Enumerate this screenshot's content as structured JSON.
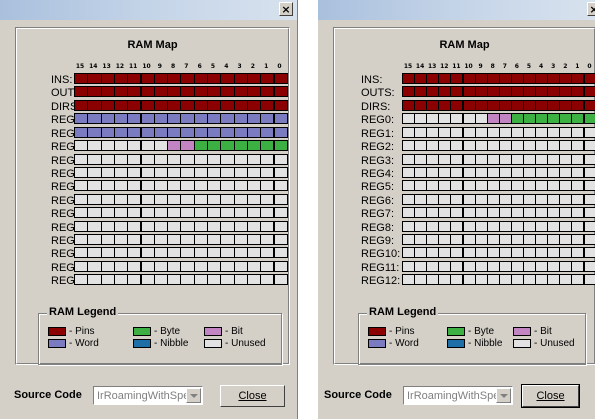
{
  "window_close_glyph": "×",
  "ram_map_title": "RAM Map",
  "bit_numbers": [
    "15",
    "14",
    "13",
    "12",
    "11",
    "10",
    "9",
    "8",
    "7",
    "6",
    "5",
    "4",
    "3",
    "2",
    "1",
    "0"
  ],
  "colors": {
    "pins": "#8b0000",
    "word": "#7b7bc1",
    "byte": "#3cb043",
    "nibble": "#1e6fa8",
    "bit": "#c384c3",
    "unused": "#e2e2e2"
  },
  "register_labels": [
    "INS:",
    "OUTS:",
    "DIRS:",
    "REG0:",
    "REG1:",
    "REG2:",
    "REG3:",
    "REG4:",
    "REG5:",
    "REG6:",
    "REG7:",
    "REG8:",
    "REG9:",
    "REG10:",
    "REG11:",
    "REG12:"
  ],
  "legend": {
    "title": "RAM Legend",
    "items": [
      {
        "label": "- Pins",
        "type": "pins"
      },
      {
        "label": "- Byte",
        "type": "byte"
      },
      {
        "label": "- Bit",
        "type": "bit"
      },
      {
        "label": "- Word",
        "type": "word"
      },
      {
        "label": "- Nibble",
        "type": "nibble"
      },
      {
        "label": "- Unused",
        "type": "unused"
      }
    ]
  },
  "source_code_label": "Source Code",
  "source_code_value": "IrRoamingWithSpe",
  "close_label": "Close",
  "maps": [
    {
      "rows": [
        "pppppppppppppppp",
        "pppppppppppppppp",
        "pppppppppppppppp",
        "wwwwwwwwwwwwwwww",
        "wwwwwwwwwwwwwwww",
        "uuuuuuuttbbbbbbbb",
        "uuuuuuuuuuuuuuuu",
        "uuuuuuuuuuuuuuuu",
        "uuuuuuuuuuuuuuuu",
        "uuuuuuuuuuuuuuuu",
        "uuuuuuuuuuuuuuuu",
        "uuuuuuuuuuuuuuuu",
        "uuuuuuuuuuuuuuuu",
        "uuuuuuuuuuuuuuuu",
        "uuuuuuuuuuuuuuuu",
        "uuuuuuuuuuuuuuuu"
      ]
    },
    {
      "rows": [
        "pppppppppppppppp",
        "pppppppppppppppp",
        "pppppppppppppppp",
        "uuuuuuuttbbbbbbbb",
        "uuuuuuuuuuuuuuuu",
        "uuuuuuuuuuuuuuuu",
        "uuuuuuuuuuuuuuuu",
        "uuuuuuuuuuuuuuuu",
        "uuuuuuuuuuuuuuuu",
        "uuuuuuuuuuuuuuuu",
        "uuuuuuuuuuuuuuuu",
        "uuuuuuuuuuuuuuuu",
        "uuuuuuuuuuuuuuuu",
        "uuuuuuuuuuuuuuuu",
        "uuuuuuuuuuuuuuuu",
        "uuuuuuuuuuuuuuuu"
      ]
    }
  ]
}
